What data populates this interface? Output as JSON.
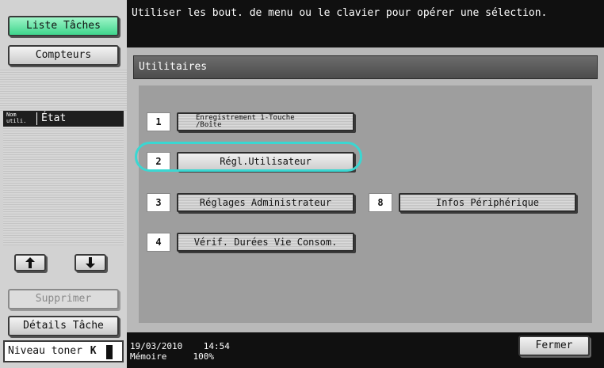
{
  "left": {
    "liste_taches": "Liste Tâches",
    "compteurs": "Compteurs",
    "col_nom": "Nom\nutili.",
    "col_etat": "État",
    "supprimer": "Supprimer",
    "details_tache": "Détails Tâche",
    "toner_label": "Niveau toner",
    "toner_color": "K"
  },
  "message": "Utiliser les bout. de menu ou le clavier pour opérer une sélection.",
  "main": {
    "title": "Utilitaires",
    "items": [
      {
        "num": "1",
        "label": "Enregistrement 1-Touche\n/Boîte"
      },
      {
        "num": "2",
        "label": "Régl.Utilisateur"
      },
      {
        "num": "3",
        "label": "Réglages Administrateur"
      },
      {
        "num": "8",
        "label": "Infos Périphérique"
      },
      {
        "num": "4",
        "label": "Vérif. Durées Vie Consom."
      }
    ]
  },
  "bottom": {
    "date": "19/03/2010",
    "time": "14:54",
    "memory_label": "Mémoire",
    "memory_value": "100%",
    "fermer": "Fermer"
  },
  "colors": {
    "accent_green": "#3fd58c",
    "highlight_cyan": "#3ad7d2",
    "bar_dark": "#101010"
  }
}
